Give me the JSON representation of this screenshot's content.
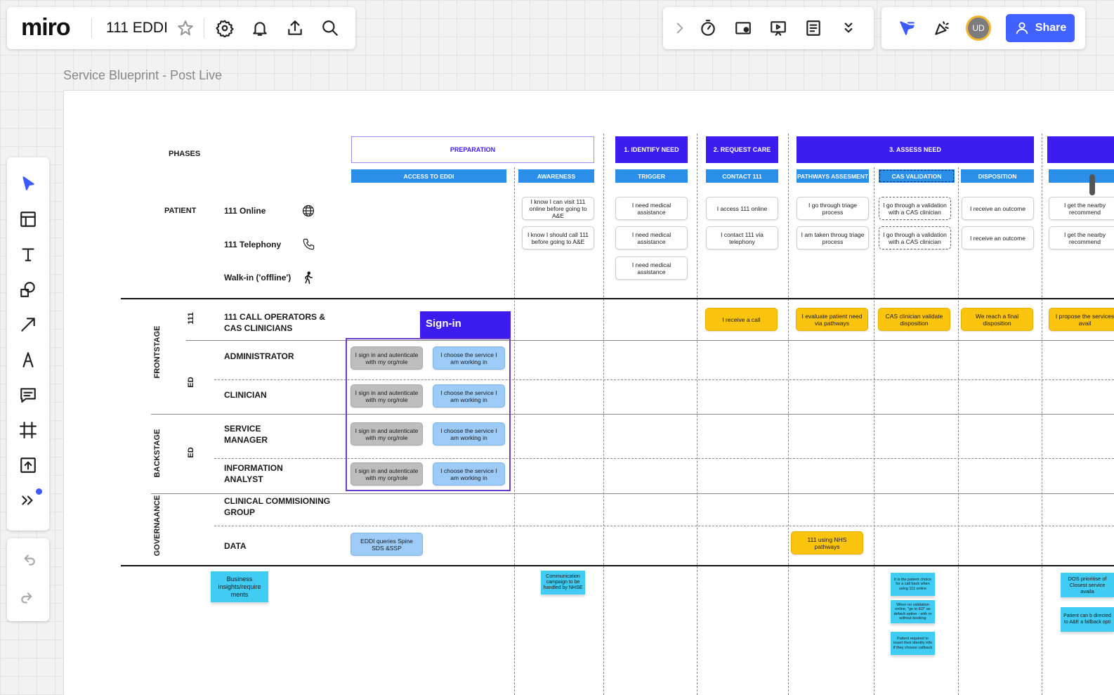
{
  "app": {
    "logo": "miro",
    "board_title": "111 EDDI"
  },
  "topbar_right": {
    "share_label": "Share",
    "avatar_initials": "UD"
  },
  "frame": {
    "title": "Service Blueprint - Post Live"
  },
  "rows": {
    "phases": "PHASES",
    "patient": "PATIENT",
    "online": "111 Online",
    "telephony": "111 Telephony",
    "walkin": "Walk-in ('offline')",
    "frontstage": "FRONTSTAGE",
    "backstage": "BACKSTAGE",
    "governance": "GOVERNAANCE",
    "g111": "111",
    "ged1": "ED",
    "ged2": "ED",
    "call_ops_1": "111 CALL OPERATORS &",
    "call_ops_2": "CAS CLINICIANS",
    "administrator": "ADMINISTRATOR",
    "clinician": "CLINICIAN",
    "service_manager_1": "SERVICE",
    "service_manager_2": "MANAGER",
    "info_analyst_1": "INFORMATION",
    "info_analyst_2": "ANALYST",
    "ccg_1": "CLINICAL COMMISIONING",
    "ccg_2": "GROUP",
    "data": "DATA"
  },
  "phases": {
    "preparation": "PREPARATION",
    "identify": "1. IDENTIFY NEED",
    "request": "2. REQUEST CARE",
    "assess": "3. ASSESS NEED"
  },
  "subphases": {
    "access": "ACCESS TO EDDI",
    "awareness": "AWARENESS",
    "trigger": "TRIGGER",
    "contact": "CONTACT 111",
    "pathways": "PATHWAYS ASSESMENT",
    "cas": "CAS VALIDATION",
    "disposition": "DISPOSITION"
  },
  "signin_label": "Sign-in",
  "cards": {
    "aw1": "I know I can visit 111 online before going to A&E",
    "aw2": "I know I should call 111 before going to A&E",
    "tr1": "I need medical assistance",
    "tr2": "I need medical assistance",
    "tr3": "I need medical assistance",
    "co1": "I access 111 online",
    "co2": "I contact 111 via telephony",
    "pa1": "I  go through triage process",
    "pa2": "I am taken throug triage process",
    "ca1": "I go through a validation with a CAS clinician",
    "ca2": "I go through a validation with a CAS clinician",
    "di1": "I receive an outcome",
    "di2": "I receive an outcome",
    "nx1": "I get the nearby recommend",
    "nx2": "I get the nearby recommend",
    "receive_call": "I receive a call",
    "evaluate": "I evaluate patient need via pathways",
    "cas_validate": "CAS clinician validate disposition",
    "final_disp": "We reach a final disposition",
    "propose": "I propose the services avail",
    "signin_gray": "I sign in and autenticate with my org/role",
    "choose_service": "I choose the service I am working in",
    "eddi_queries": "EDDI queries Spine SDS &SSP",
    "nhs_pathways": "111 using NHS pathways"
  },
  "stickies": {
    "business": "Business insights/require ments",
    "comms": "Communication campaign to be handled by NHSE",
    "s1": "It is the patient choice for a call back when using 111 online",
    "s2": "When no validation online, \"go to ED\" as default option - with or without booking",
    "s3": "Patient required to insert their identity info if they choose callback",
    "dos": "DOS prioritise of Closest service availa",
    "ae": "Patient can b directed to A&E a fallback opti"
  },
  "colors": {
    "phase": "#3d1cf0",
    "subphase": "#2b8ee8",
    "share": "#4262ff",
    "yellow": "#fbc40f",
    "sticky": "#40ccf3"
  }
}
